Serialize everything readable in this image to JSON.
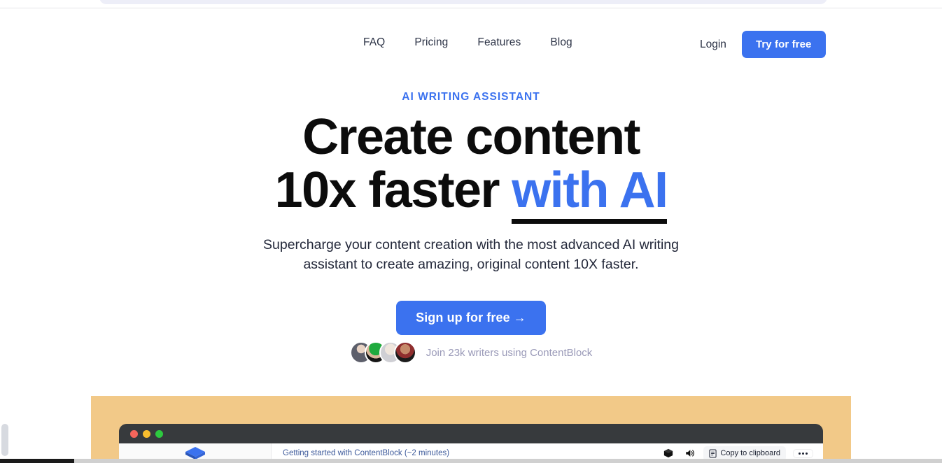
{
  "nav": {
    "links": [
      {
        "label": "FAQ",
        "name": "nav-link-faq"
      },
      {
        "label": "Pricing",
        "name": "nav-link-pricing"
      },
      {
        "label": "Features",
        "name": "nav-link-features"
      },
      {
        "label": "Blog",
        "name": "nav-link-blog"
      }
    ],
    "login_label": "Login",
    "cta_label": "Try for free"
  },
  "hero": {
    "eyebrow": "AI WRITING ASSISTANT",
    "headline_line1": "Create content",
    "headline_line2_plain": "10x faster ",
    "headline_line2_accent": "with AI",
    "subtitle": "Supercharge your content creation with the most advanced AI writing assistant to create amazing, original content 10X faster.",
    "cta_label": "Sign up for free →",
    "social_proof": "Join 23k writers using ContentBlock",
    "avatar_count": 4
  },
  "showcase": {
    "window_dots": [
      "red",
      "yellow",
      "green"
    ],
    "doc_title": "Getting started with ContentBlock (~2 minutes)",
    "copy_label": "Copy to clipboard",
    "icons": [
      "cube-icon",
      "speaker-icon",
      "document-icon",
      "ellipsis-icon"
    ]
  },
  "colors": {
    "brand_blue": "#3b72ef",
    "headline_black": "#0c0c0c",
    "nav_text": "#2b3245",
    "muted_text": "#9a9ab8",
    "showcase_bg": "#f2c988",
    "window_chrome": "#373a3d",
    "doc_title_blue": "#3d5a9b"
  }
}
